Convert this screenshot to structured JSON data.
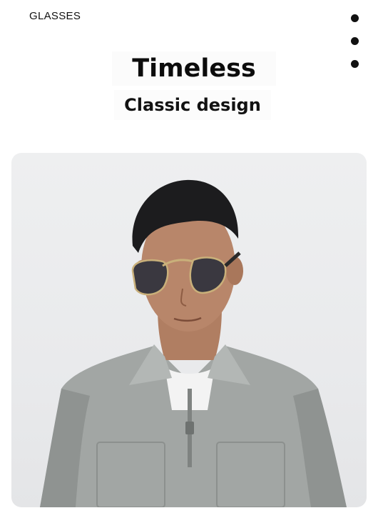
{
  "header": {
    "brand": "GLASSES",
    "menu_icon": "more-vertical-icon"
  },
  "hero": {
    "title": "Timeless",
    "subtitle": "Classic design"
  },
  "photo": {
    "subject": "model-wearing-aviator-sunglasses",
    "background_color": "#eaebed",
    "shirt_color": "#9fa3a1",
    "lens_color": "#3a3840",
    "frame_color": "#c9b07a"
  }
}
